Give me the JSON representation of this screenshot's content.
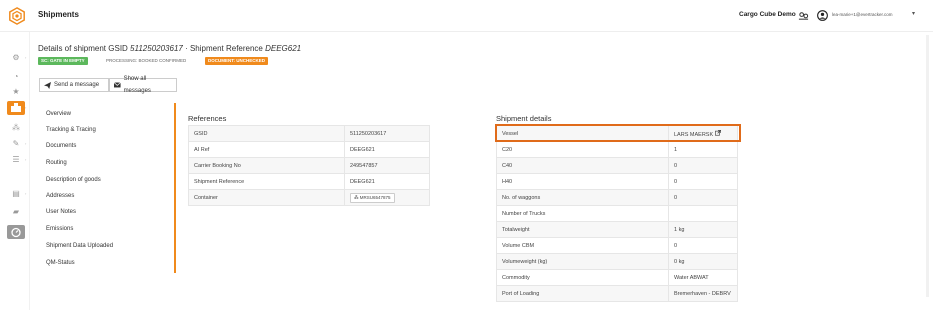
{
  "header": {
    "app_title": "Shipments",
    "company": "Cargo Cube Demo",
    "user_email": "lea-marie+1@evertracker.com",
    "user_caret": "▾"
  },
  "shipment": {
    "title_prefix": "Details of shipment GSID ",
    "gsid": "511250203617",
    "title_mid": " · Shipment Reference ",
    "reference": "DEEG621",
    "badges": {
      "sc": "SC: GATE IN EMPTY",
      "processing": "PROCESSING: BOOKED CONFIRMED",
      "document": "DOCUMENT: UNCHECKED"
    }
  },
  "actions": {
    "send_message": "Send a message",
    "show_messages": "Show all messages"
  },
  "nav": {
    "items": [
      "Overview",
      "Tracking & Tracing",
      "Documents",
      "Routing",
      "Description of goods",
      "Addresses",
      "User Notes",
      "Emissions",
      "Shipment Data Uploaded",
      "QM-Status"
    ]
  },
  "references": {
    "title": "References",
    "rows": [
      {
        "label": "GSID",
        "value": "511250203617"
      },
      {
        "label": "AI Ref",
        "value": "DEEG621"
      },
      {
        "label": "Carrier Booking No",
        "value": "249547857"
      },
      {
        "label": "Shipment Reference",
        "value": "DEEG621"
      },
      {
        "label": "Container",
        "value": "MRSU6547875"
      }
    ]
  },
  "shipment_details": {
    "title": "Shipment details",
    "rows": [
      {
        "label": "Vessel",
        "value": "LARS MAERSK"
      },
      {
        "label": "C20",
        "value": "1"
      },
      {
        "label": "C40",
        "value": "0"
      },
      {
        "label": "H40",
        "value": "0"
      },
      {
        "label": "No. of waggons",
        "value": "0"
      },
      {
        "label": "Number of Trucks",
        "value": ""
      },
      {
        "label": "Totalweight",
        "value": "1 kg"
      },
      {
        "label": "Volume CBM",
        "value": "0"
      },
      {
        "label": "Volumeweight (kg)",
        "value": "0 kg"
      },
      {
        "label": "Commodity",
        "value": "Water ABWAT"
      },
      {
        "label": "Port of Loading",
        "value": "Bremerhaven - DEBRV"
      }
    ]
  },
  "colors": {
    "accent": "#f08a1c",
    "success": "#5cb85c",
    "highlight": "#e06b1a"
  }
}
